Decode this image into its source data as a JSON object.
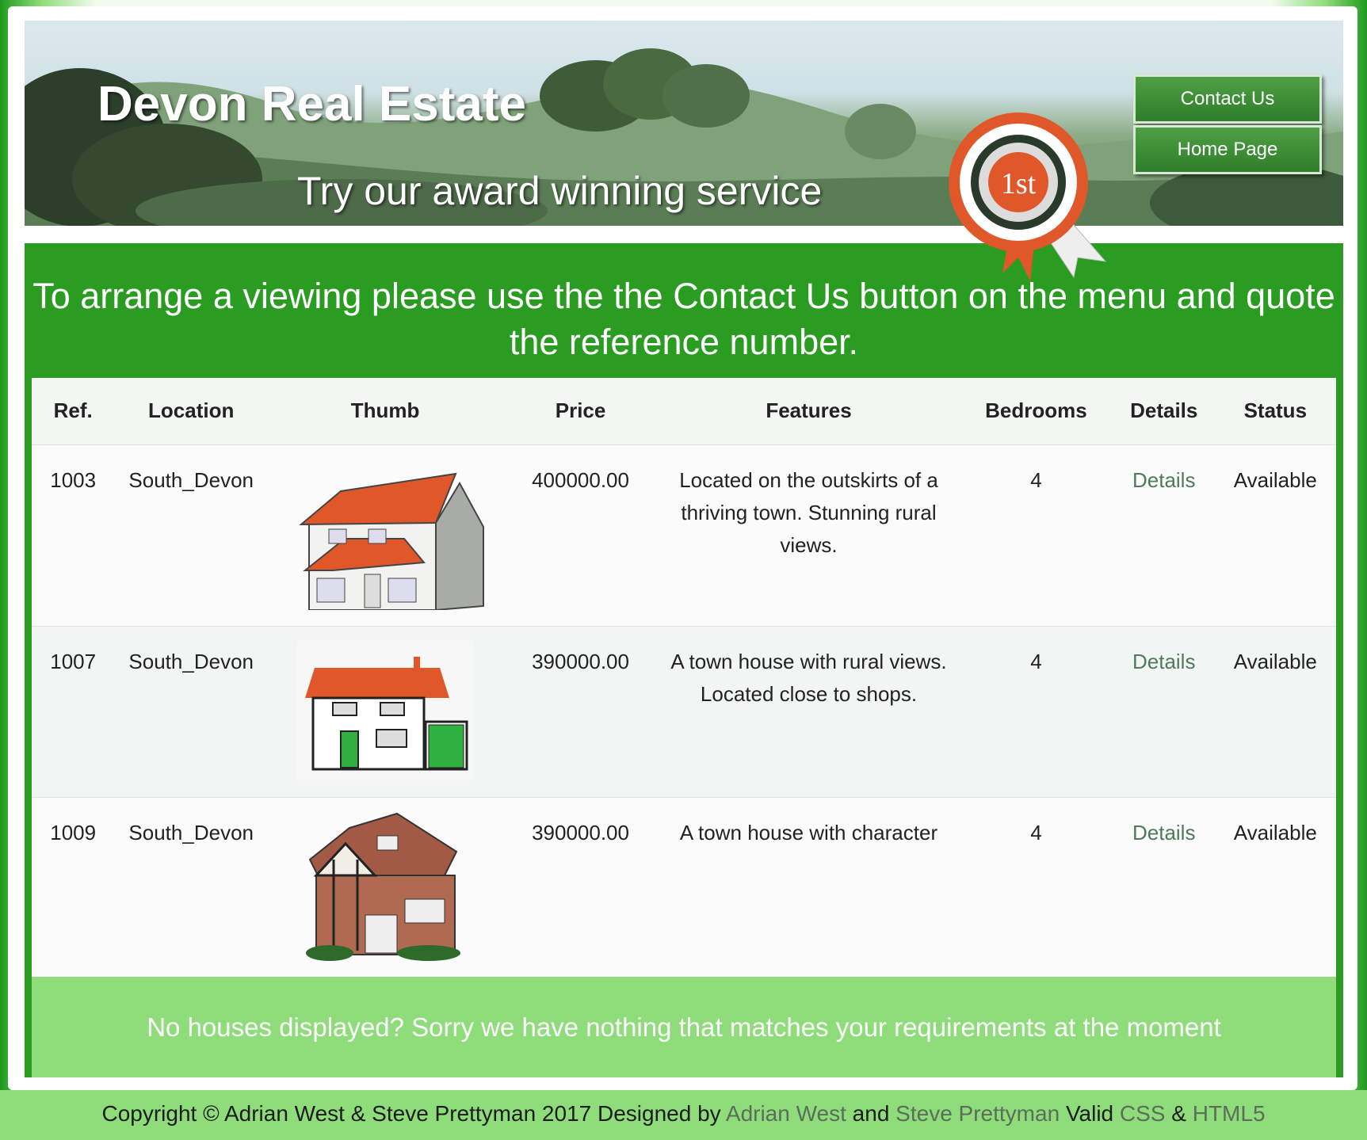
{
  "header": {
    "title": "Devon Real Estate",
    "tagline": "Try our award winning service",
    "rosette_text": "1st",
    "nav": [
      {
        "label": "Contact Us"
      },
      {
        "label": "Home Page"
      }
    ]
  },
  "notice": "To arrange a viewing please use the the Contact Us button on the menu and quote the reference number.",
  "table": {
    "headers": [
      "Ref.",
      "Location",
      "Thumb",
      "Price",
      "Features",
      "Bedrooms",
      "Details",
      "Status"
    ],
    "rows": [
      {
        "ref": "1003",
        "location": "South_Devon",
        "price": "400000.00",
        "features": "Located on the outskirts of a thriving town. Stunning rural views.",
        "bedrooms": "4",
        "details": "Details",
        "status": "Available"
      },
      {
        "ref": "1007",
        "location": "South_Devon",
        "price": "390000.00",
        "features": "A town house with rural views. Located close to shops.",
        "bedrooms": "4",
        "details": "Details",
        "status": "Available"
      },
      {
        "ref": "1009",
        "location": "South_Devon",
        "price": "390000.00",
        "features": "A town house with character",
        "bedrooms": "4",
        "details": "Details",
        "status": "Available"
      }
    ]
  },
  "no_houses_message": "No houses displayed? Sorry we have nothing that matches your requirements at the moment",
  "footer": {
    "copyright": "Copyright © Adrian West & Steve Prettyman 2017 Designed by",
    "author1": "Adrian West",
    "and": "and",
    "author2": "Steve Prettyman",
    "valid": "Valid",
    "css": "CSS",
    "amp": "&",
    "html5": "HTML5"
  },
  "colors": {
    "brand_green": "#2a9c22",
    "light_green": "#8fdc7a",
    "roof_orange": "#e0582a"
  }
}
